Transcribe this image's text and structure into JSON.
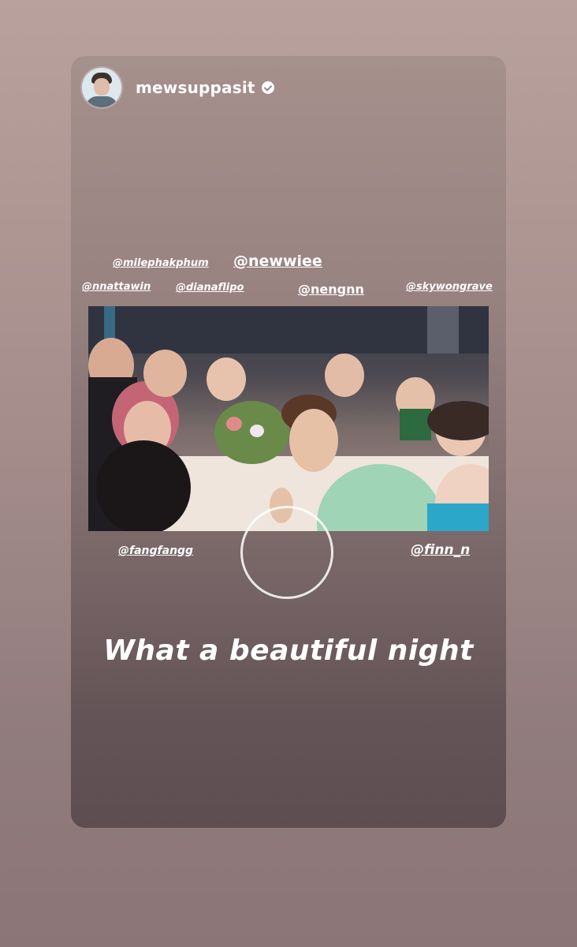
{
  "story": {
    "username": "mewsuppasit",
    "verified": true,
    "caption": "What a beautiful night",
    "mentions": {
      "milephakphum": "@milephakphum",
      "newwiee": "@newwiee",
      "nnattawin": "@nnattawin",
      "dianaflipo": "@dianaflipo",
      "nengnn": "@nengnn",
      "skywongravee": "@skywongrave",
      "fangfangg": "@fangfangg",
      "finn_n": "@finn_n"
    }
  },
  "icons": {
    "verified": "verified-badge-icon",
    "capture": "capture-ring-icon"
  },
  "colors": {
    "card_top": "#a5908c",
    "card_bottom": "#5d4d51",
    "text": "#ffffff"
  }
}
